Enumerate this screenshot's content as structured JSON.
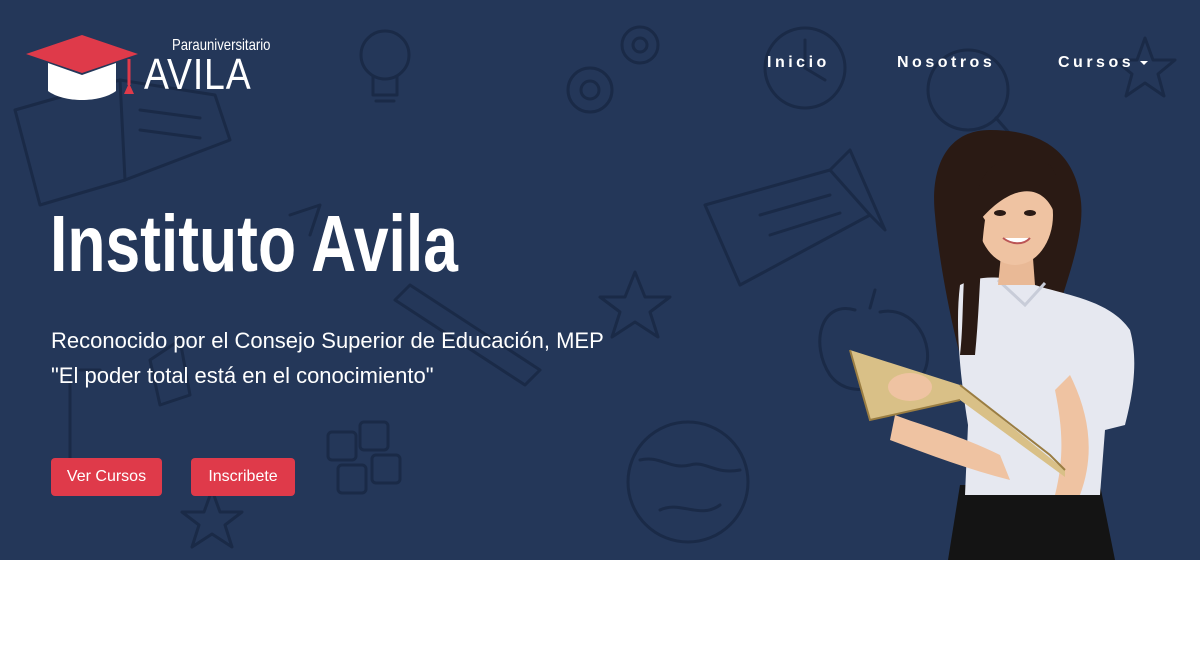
{
  "brand": {
    "small_text": "Parauniversitario",
    "big_text": "AVILA",
    "accent_color": "#df3a4a",
    "background_color": "#243759"
  },
  "nav": {
    "items": [
      {
        "label": "Inicio"
      },
      {
        "label": "Nosotros"
      },
      {
        "label": "Cursos",
        "has_dropdown": true
      }
    ]
  },
  "hero": {
    "title": "Instituto Avila",
    "subtitle_line1": "Reconocido por el Consejo Superior de Educación, MEP",
    "subtitle_line2": "\"El poder total está en el conocimiento\"",
    "buttons": {
      "cursos": "Ver Cursos",
      "inscribete": "Inscribete"
    },
    "icons": [
      "graduation-cap-icon",
      "lightbulb-icon",
      "gear-icon",
      "book-icon",
      "star-icon",
      "magnifier-icon",
      "apple-icon",
      "globe-icon",
      "calculator-icon",
      "ruler-icon",
      "clock-icon",
      "chevron-down-icon"
    ]
  }
}
